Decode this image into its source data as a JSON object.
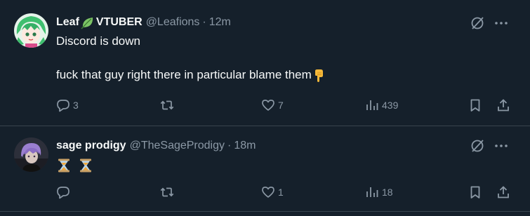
{
  "tweets": [
    {
      "display_name": "Leaf",
      "display_name_suffix": "VTUBER",
      "handle": "@Leafions",
      "separator": "·",
      "time": "12m",
      "text_line1": "Discord is down",
      "text_line2": "fuck that guy right there in particular blame them",
      "avatar_icon": "avatar-anime-green-hair",
      "emoji_icon": "pointing-down-icon",
      "counts": {
        "replies": "3",
        "retweets": "",
        "likes": "7",
        "views": "439"
      }
    },
    {
      "display_name": "sage prodigy",
      "handle": "@TheSageProdigy",
      "separator": "·",
      "time": "18m",
      "text_line1": "",
      "avatar_icon": "avatar-purple-hair",
      "emoji_icon": "hourglass-icon",
      "counts": {
        "replies": "",
        "retweets": "",
        "likes": "1",
        "views": "18"
      }
    }
  ],
  "colors": {
    "background": "#15202b",
    "text": "#f7f9f9",
    "muted": "#8b98a5",
    "divider": "#38444d"
  }
}
